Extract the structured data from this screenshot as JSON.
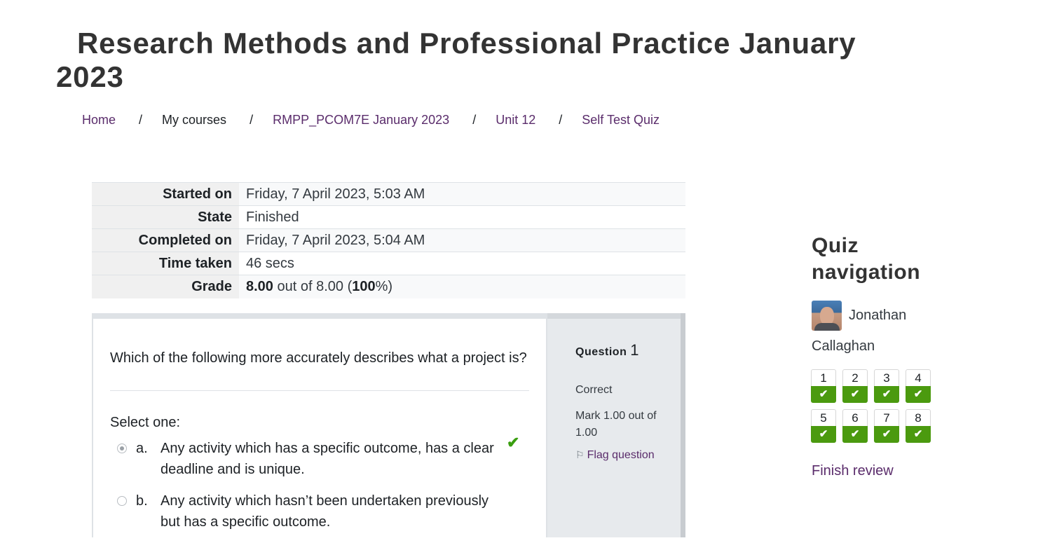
{
  "page": {
    "title": "Research Methods and Professional Practice January 2023"
  },
  "breadcrumb": [
    {
      "label": "Home"
    },
    {
      "label": "My courses"
    },
    {
      "label": "RMPP_PCOM7E January 2023"
    },
    {
      "label": "Unit 12"
    },
    {
      "label": "Self Test Quiz"
    }
  ],
  "breadcrumb_separator": "/",
  "summary": {
    "started_label": "Started on",
    "started_value": "Friday, 7 April 2023, 5:03 AM",
    "state_label": "State",
    "state_value": "Finished",
    "completed_label": "Completed on",
    "completed_value": "Friday, 7 April 2023, 5:04 AM",
    "time_label": "Time taken",
    "time_value": "46 secs",
    "grade_label": "Grade",
    "grade_score": "8.00",
    "grade_outof": " out of 8.00 (",
    "grade_percent": "100",
    "grade_end": "%)"
  },
  "question": {
    "text": "Which of the following more accurately describes what a project is?",
    "select_label": "Select one:",
    "answers": [
      {
        "letter": "a.",
        "text": "Any activity which has a specific outcome, has a clear deadline and is unique.",
        "selected": true,
        "correct": true
      },
      {
        "letter": "b.",
        "text": "Any activity which hasn’t been undertaken previously but has a specific outcome.",
        "selected": false,
        "correct": false
      }
    ],
    "info": {
      "number_label": "Question",
      "number": "1",
      "state": "Correct",
      "mark": "Mark 1.00 out of 1.00",
      "flag_label": "Flag question"
    }
  },
  "quiz_nav": {
    "title": "Quiz navigation",
    "user_first": "Jonathan",
    "user_last": "Callaghan",
    "questions": [
      "1",
      "2",
      "3",
      "4",
      "5",
      "6",
      "7",
      "8"
    ],
    "finish_label": "Finish review"
  },
  "colors": {
    "link": "#5a2c6b",
    "correct": "#4b9a0f"
  }
}
